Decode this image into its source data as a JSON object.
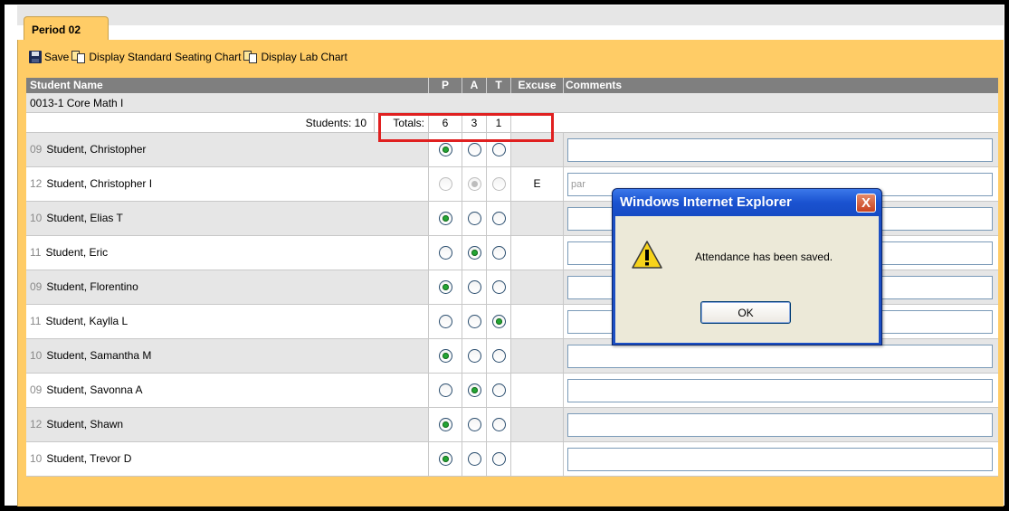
{
  "tab": {
    "label": "Period 02"
  },
  "toolbar": {
    "save_label": "Save",
    "standard_chart_label": "Display Standard Seating Chart",
    "lab_chart_label": "Display Lab Chart"
  },
  "grid": {
    "headers": {
      "name": "Student Name",
      "p": "P",
      "a": "A",
      "t": "T",
      "excuse": "Excuse",
      "comments": "Comments"
    },
    "course": "0013-1 Core Math I",
    "totals": {
      "students": "Students: 10",
      "label": "Totals:",
      "p": "6",
      "a": "3",
      "t": "1"
    },
    "rows": [
      {
        "grade": "09",
        "name": "Student, Christopher",
        "status": "P",
        "disabled": false,
        "excuse": "",
        "comment": ""
      },
      {
        "grade": "12",
        "name": "Student, Christopher I",
        "status": "A",
        "disabled": true,
        "excuse": "E",
        "comment": "par"
      },
      {
        "grade": "10",
        "name": "Student, Elias T",
        "status": "P",
        "disabled": false,
        "excuse": "",
        "comment": ""
      },
      {
        "grade": "11",
        "name": "Student, Eric",
        "status": "A",
        "disabled": false,
        "excuse": "",
        "comment": ""
      },
      {
        "grade": "09",
        "name": "Student, Florentino",
        "status": "P",
        "disabled": false,
        "excuse": "",
        "comment": ""
      },
      {
        "grade": "11",
        "name": "Student, Kaylla L",
        "status": "T",
        "disabled": false,
        "excuse": "",
        "comment": ""
      },
      {
        "grade": "10",
        "name": "Student, Samantha M",
        "status": "P",
        "disabled": false,
        "excuse": "",
        "comment": ""
      },
      {
        "grade": "09",
        "name": "Student, Savonna A",
        "status": "A",
        "disabled": false,
        "excuse": "",
        "comment": ""
      },
      {
        "grade": "12",
        "name": "Student, Shawn",
        "status": "P",
        "disabled": false,
        "excuse": "",
        "comment": ""
      },
      {
        "grade": "10",
        "name": "Student, Trevor D",
        "status": "P",
        "disabled": false,
        "excuse": "",
        "comment": ""
      }
    ]
  },
  "dialog": {
    "title": "Windows Internet Explorer",
    "close_glyph": "X",
    "message": "Attendance has been saved.",
    "ok_label": "OK",
    "icon": "warning-icon"
  },
  "colors": {
    "panel": "#ffcc66",
    "header": "#7f7f7f",
    "highlight": "#e02020",
    "dialog_title": "#1a52d0"
  }
}
